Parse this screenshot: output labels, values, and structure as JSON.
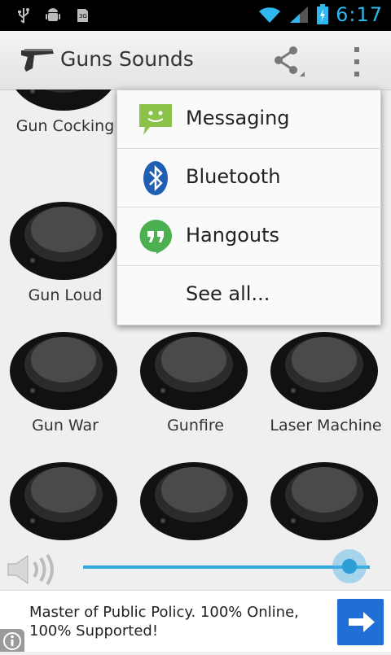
{
  "status_bar": {
    "time": "6:17",
    "icons": [
      "usb-icon",
      "android-icon",
      "sd-card-icon",
      "wifi-icon",
      "signal-icon",
      "battery-icon"
    ]
  },
  "action_bar": {
    "title": "Guns Sounds",
    "app_icon": "pistol-icon",
    "share_icon": "share-icon",
    "overflow_icon": "overflow-menu-icon"
  },
  "grid": {
    "items": [
      {
        "label": "Gun Cocking"
      },
      {
        "label": ""
      },
      {
        "label": ""
      },
      {
        "label": "Gun Loud"
      },
      {
        "label": ""
      },
      {
        "label": ""
      },
      {
        "label": "Gun War"
      },
      {
        "label": "Gunfire"
      },
      {
        "label": "Laser Machine"
      },
      {
        "label": ""
      },
      {
        "label": ""
      },
      {
        "label": ""
      }
    ]
  },
  "share_menu": {
    "items": [
      {
        "label": "Messaging",
        "icon": "messaging-icon"
      },
      {
        "label": "Bluetooth",
        "icon": "bluetooth-icon"
      },
      {
        "label": "Hangouts",
        "icon": "hangouts-icon"
      },
      {
        "label": "See all..."
      }
    ]
  },
  "volume": {
    "level": 0.93,
    "accent": "#33a8dd"
  },
  "ad": {
    "text": "Master of Public Policy. 100% Online, 100% Supported!",
    "button_icon": "arrow-right-icon",
    "info_icon": "info-icon",
    "button_color": "#1f6fd6"
  }
}
